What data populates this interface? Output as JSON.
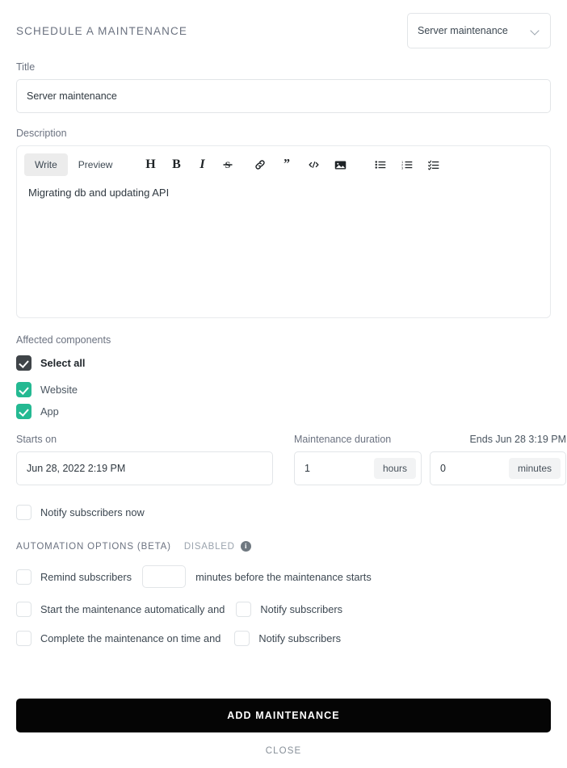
{
  "header": {
    "title": "SCHEDULE A MAINTENANCE",
    "selected_template": "Server maintenance",
    "chevron_icon": "chevron-down-icon"
  },
  "title_field": {
    "label": "Title",
    "value": "Server maintenance"
  },
  "description": {
    "label": "Description",
    "tabs": [
      {
        "label": "Write",
        "active": true
      },
      {
        "label": "Preview",
        "active": false
      }
    ],
    "toolbar": [
      {
        "icon": "heading-icon",
        "glyph": "H"
      },
      {
        "icon": "bold-icon",
        "glyph": "B"
      },
      {
        "icon": "italic-icon",
        "glyph": "I"
      },
      {
        "icon": "strikethrough-icon",
        "glyph": "S"
      },
      {
        "icon": "link-icon",
        "glyph": ""
      },
      {
        "icon": "quote-icon",
        "glyph": "”"
      },
      {
        "icon": "code-icon",
        "glyph": "</>"
      },
      {
        "icon": "image-icon",
        "glyph": ""
      },
      {
        "icon": "bulleted-list-icon",
        "glyph": ""
      },
      {
        "icon": "numbered-list-icon",
        "glyph": ""
      },
      {
        "icon": "task-list-icon",
        "glyph": ""
      }
    ],
    "body": "Migrating db and updating API"
  },
  "components": {
    "label": "Affected components",
    "select_all": {
      "label": "Select all",
      "checked": true,
      "style": "dark"
    },
    "items": [
      {
        "label": "Website",
        "checked": true,
        "style": "teal"
      },
      {
        "label": "App",
        "checked": true,
        "style": "teal"
      }
    ]
  },
  "schedule": {
    "starts_label": "Starts on",
    "starts_value": "Jun 28, 2022 2:19 PM",
    "duration_label": "Maintenance duration",
    "hours_value": "1",
    "hours_suffix": "hours",
    "minutes_value": "0",
    "minutes_suffix": "minutes",
    "ends_label": "Ends Jun 28 3:19 PM"
  },
  "notify_now": {
    "label": "Notify subscribers now",
    "checked": false
  },
  "automation": {
    "title": "AUTOMATION OPTIONS (BETA)",
    "status": "DISABLED",
    "info_icon": "info-icon",
    "rows": [
      {
        "checkbox_label": "Remind subscribers",
        "input_value": "",
        "trailing_text": "minutes before the maintenance starts",
        "checked": false
      },
      {
        "checkbox_label": "Start the maintenance automatically and",
        "second_label": "Notify subscribers",
        "checked": false,
        "second_checked": false
      },
      {
        "checkbox_label": "Complete the maintenance on time and",
        "second_label": "Notify subscribers",
        "checked": false,
        "second_checked": false
      }
    ]
  },
  "footer": {
    "primary_label": "ADD MAINTENANCE",
    "close_label": "CLOSE"
  },
  "colors": {
    "accent_teal": "#24b992",
    "dark_check": "#3f4448",
    "primary_button": "#050505",
    "border": "#e2e5e8",
    "muted_text": "#6b7280"
  }
}
